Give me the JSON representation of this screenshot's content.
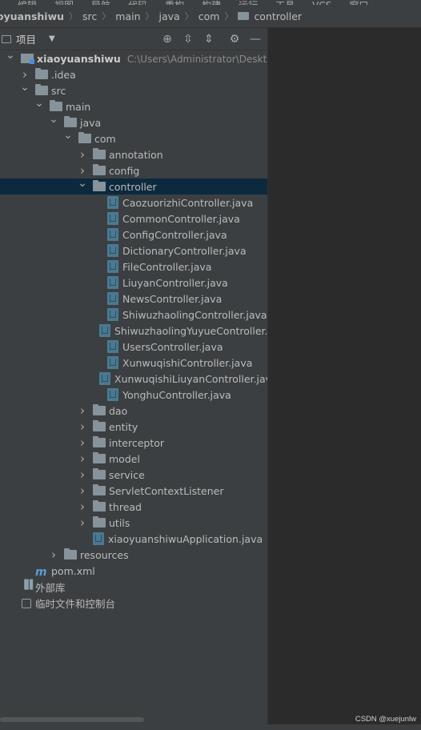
{
  "menubar": {
    "items": [
      "编辑",
      "视图",
      "导航",
      "代码",
      "重构",
      "构建",
      "运行",
      "工具",
      "VCS",
      "窗口"
    ]
  },
  "breadcrumb": [
    "oyuanshiwu",
    "src",
    "main",
    "java",
    "com",
    "controller"
  ],
  "toolbar": {
    "project_label": "项目",
    "icons": [
      "target-icon",
      "expand-all-icon",
      "collapse-all-icon",
      "gear-icon",
      "minimize-icon"
    ]
  },
  "tree": [
    {
      "label": "xiaoyuanshiwu",
      "hint": "C:\\Users\\Administrator\\Desktop\\新",
      "depth": 0,
      "icon": "module",
      "arrow": "open",
      "bold": true
    },
    {
      "label": ".idea",
      "depth": 1,
      "icon": "folder",
      "arrow": "closed"
    },
    {
      "label": "src",
      "depth": 1,
      "icon": "folder",
      "arrow": "open"
    },
    {
      "label": "main",
      "depth": 2,
      "icon": "folder",
      "arrow": "open"
    },
    {
      "label": "java",
      "depth": 3,
      "icon": "folder",
      "arrow": "open"
    },
    {
      "label": "com",
      "depth": 4,
      "icon": "folder",
      "arrow": "open"
    },
    {
      "label": "annotation",
      "depth": 5,
      "icon": "folder",
      "arrow": "closed"
    },
    {
      "label": "config",
      "depth": 5,
      "icon": "folder",
      "arrow": "closed"
    },
    {
      "label": "controller",
      "depth": 5,
      "icon": "folder",
      "arrow": "open",
      "selected": true
    },
    {
      "label": "CaozuorizhiController.java",
      "depth": 6,
      "icon": "java"
    },
    {
      "label": "CommonController.java",
      "depth": 6,
      "icon": "java"
    },
    {
      "label": "ConfigController.java",
      "depth": 6,
      "icon": "java"
    },
    {
      "label": "DictionaryController.java",
      "depth": 6,
      "icon": "java"
    },
    {
      "label": "FileController.java",
      "depth": 6,
      "icon": "java"
    },
    {
      "label": "LiuyanController.java",
      "depth": 6,
      "icon": "java"
    },
    {
      "label": "NewsController.java",
      "depth": 6,
      "icon": "java"
    },
    {
      "label": "ShiwuzhaolingController.java",
      "depth": 6,
      "icon": "java"
    },
    {
      "label": "ShiwuzhaolingYuyueController.java",
      "depth": 6,
      "icon": "java"
    },
    {
      "label": "UsersController.java",
      "depth": 6,
      "icon": "java"
    },
    {
      "label": "XunwuqishiController.java",
      "depth": 6,
      "icon": "java"
    },
    {
      "label": "XunwuqishiLiuyanController.java",
      "depth": 6,
      "icon": "java"
    },
    {
      "label": "YonghuController.java",
      "depth": 6,
      "icon": "java"
    },
    {
      "label": "dao",
      "depth": 5,
      "icon": "folder",
      "arrow": "closed"
    },
    {
      "label": "entity",
      "depth": 5,
      "icon": "folder",
      "arrow": "closed"
    },
    {
      "label": "interceptor",
      "depth": 5,
      "icon": "folder",
      "arrow": "closed"
    },
    {
      "label": "model",
      "depth": 5,
      "icon": "folder",
      "arrow": "closed"
    },
    {
      "label": "service",
      "depth": 5,
      "icon": "folder",
      "arrow": "closed"
    },
    {
      "label": "ServletContextListener",
      "depth": 5,
      "icon": "folder",
      "arrow": "closed"
    },
    {
      "label": "thread",
      "depth": 5,
      "icon": "folder",
      "arrow": "closed"
    },
    {
      "label": "utils",
      "depth": 5,
      "icon": "folder",
      "arrow": "closed"
    },
    {
      "label": "xiaoyuanshiwuApplication.java",
      "depth": 5,
      "icon": "java"
    },
    {
      "label": "resources",
      "depth": 3,
      "icon": "folder",
      "arrow": "closed"
    },
    {
      "label": "pom.xml",
      "depth": 1,
      "icon": "maven"
    },
    {
      "label": "外部库",
      "depth": 0,
      "icon": "libs"
    },
    {
      "label": "临时文件和控制台",
      "depth": 0,
      "icon": "scratch"
    }
  ],
  "watermark": "CSDN @xuejunlw"
}
